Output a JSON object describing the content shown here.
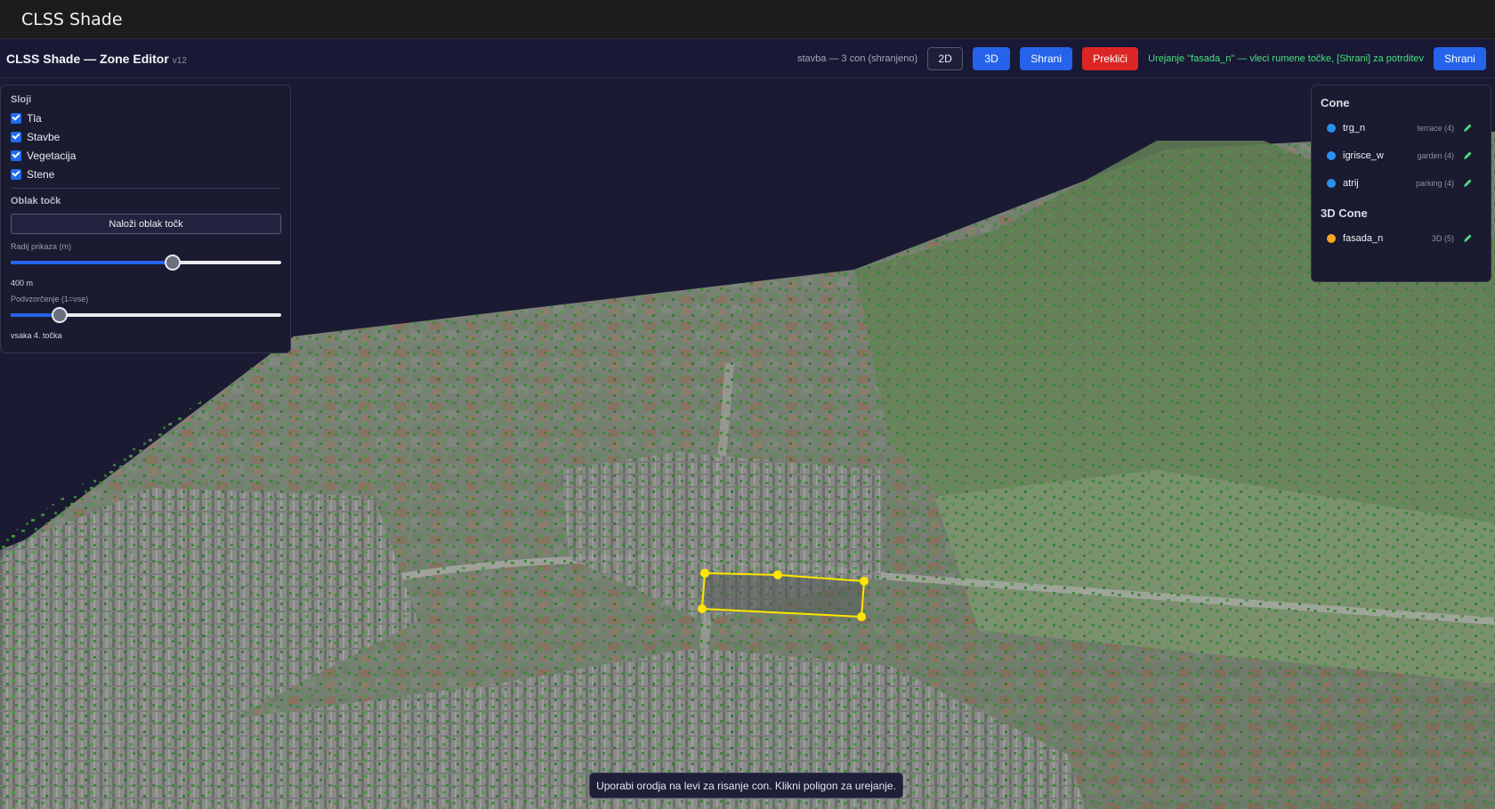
{
  "app": {
    "title": "CLSS Shade"
  },
  "toolbar": {
    "title": "CLSS Shade — Zone Editor",
    "version": "v12",
    "status": "stavba — 3 con (shranjeno)",
    "btn_2d": "2D",
    "btn_3d": "3D",
    "btn_save": "Shrani",
    "btn_cancel": "Prekliči",
    "edit_hint": "Urejanje \"fasada_n\" — vleci rumene točke, [Shrani] za potrditev",
    "btn_save2": "Shrani"
  },
  "layers": {
    "header": "Sloji",
    "items": [
      {
        "label": "Tla",
        "checked": true
      },
      {
        "label": "Stavbe",
        "checked": true
      },
      {
        "label": "Vegetacija",
        "checked": true
      },
      {
        "label": "Stene",
        "checked": true
      }
    ],
    "pointcloud": {
      "header": "Oblak točk",
      "load_button": "Naloži oblak točk",
      "radius_label": "Radij prikaza (m)",
      "radius_value": "400 m",
      "radius_fraction": 0.6,
      "subsample_label": "Podvzorčenje (1=vse)",
      "subsample_value": "vsaka 4. točka",
      "subsample_fraction": 0.18
    }
  },
  "zones": {
    "header": "Cone",
    "items": [
      {
        "name": "trg_n",
        "meta": "terrace (4)",
        "color": "#2b8ff0"
      },
      {
        "name": "igrisce_w",
        "meta": "garden (4)",
        "color": "#2b8ff0"
      },
      {
        "name": "atrij",
        "meta": "parking (4)",
        "color": "#2b8ff0"
      }
    ],
    "header3d": "3D Cone",
    "items3d": [
      {
        "name": "fasada_n",
        "meta": "3D (5)",
        "color": "#f5a623"
      }
    ],
    "edit_icon_color": "#4ade80"
  },
  "selection": {
    "outline_color": "#ffe500",
    "point_count": 5
  },
  "footer": {
    "hint": "Uporabi orodja na levi za risanje con. Klikni poligon za urejanje."
  }
}
